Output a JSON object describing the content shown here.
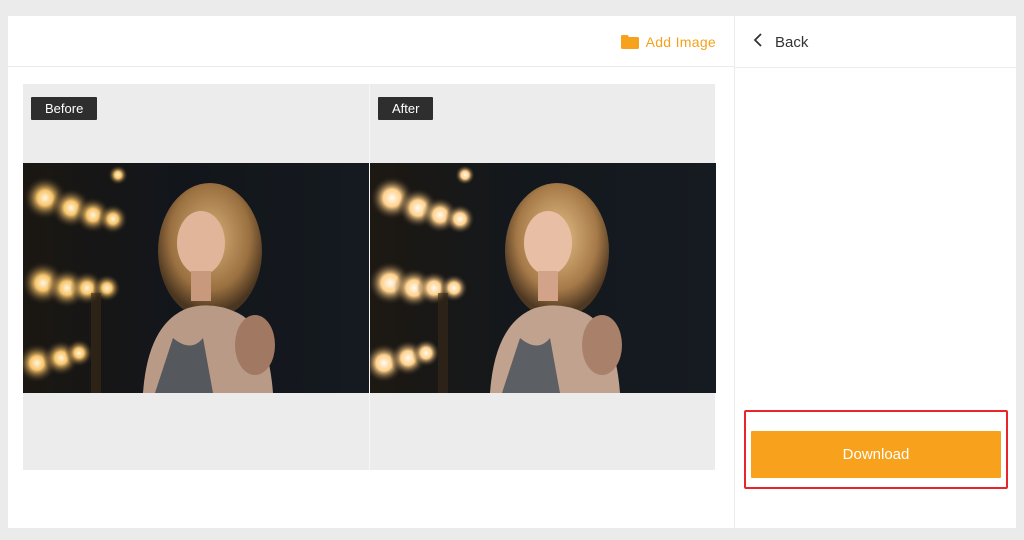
{
  "toolbar": {
    "add_image_label": "Add Image",
    "add_image_icon": "folder-icon"
  },
  "compare": {
    "before_label": "Before",
    "after_label": "After"
  },
  "side_panel": {
    "back_label": "Back",
    "back_icon": "chevron-left-icon",
    "download_label": "Download"
  },
  "colors": {
    "accent": "#f7a11d",
    "highlight": "#e8262a",
    "tag_bg": "#2e2e2e"
  }
}
